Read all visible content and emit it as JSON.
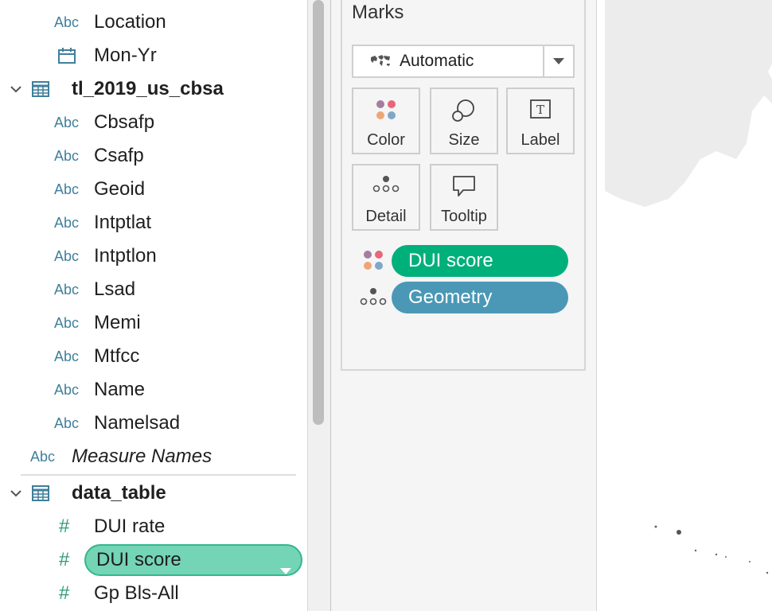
{
  "data_pane": {
    "fields_top": [
      {
        "type": "Abc",
        "name": "Location"
      },
      {
        "type": "date",
        "name": "Mon-Yr"
      }
    ],
    "table1": {
      "name": "tl_2019_us_cbsa",
      "fields": [
        {
          "type": "Abc",
          "name": "Cbsafp"
        },
        {
          "type": "Abc",
          "name": "Csafp"
        },
        {
          "type": "Abc",
          "name": "Geoid"
        },
        {
          "type": "Abc",
          "name": "Intptlat"
        },
        {
          "type": "Abc",
          "name": "Intptlon"
        },
        {
          "type": "Abc",
          "name": "Lsad"
        },
        {
          "type": "Abc",
          "name": "Memi"
        },
        {
          "type": "Abc",
          "name": "Mtfcc"
        },
        {
          "type": "Abc",
          "name": "Name"
        },
        {
          "type": "Abc",
          "name": "Namelsad"
        }
      ]
    },
    "measure_names": {
      "type": "Abc",
      "name": "Measure Names"
    },
    "table2": {
      "name": "data_table",
      "fields": [
        {
          "type": "#",
          "name": "DUI rate"
        },
        {
          "type": "#",
          "name": "DUI score"
        },
        {
          "type": "#",
          "name": "Gp Bls-All"
        }
      ]
    }
  },
  "marks": {
    "title": "Marks",
    "mark_type": "Automatic",
    "buttons": {
      "color": "Color",
      "size": "Size",
      "label": "Label",
      "detail": "Detail",
      "tooltip": "Tooltip"
    },
    "shelf": [
      {
        "label": "DUI score",
        "icon": "color-dots-icon"
      },
      {
        "label": "Geometry",
        "icon": "detail-icon"
      }
    ]
  },
  "colors": {
    "dimension_blue": "#3f7f9b",
    "measure_green": "#2e9b77",
    "pill_green": "#00b07b",
    "pill_blue": "#4a98b6",
    "selected_pill_fill": "#73d4b6"
  }
}
